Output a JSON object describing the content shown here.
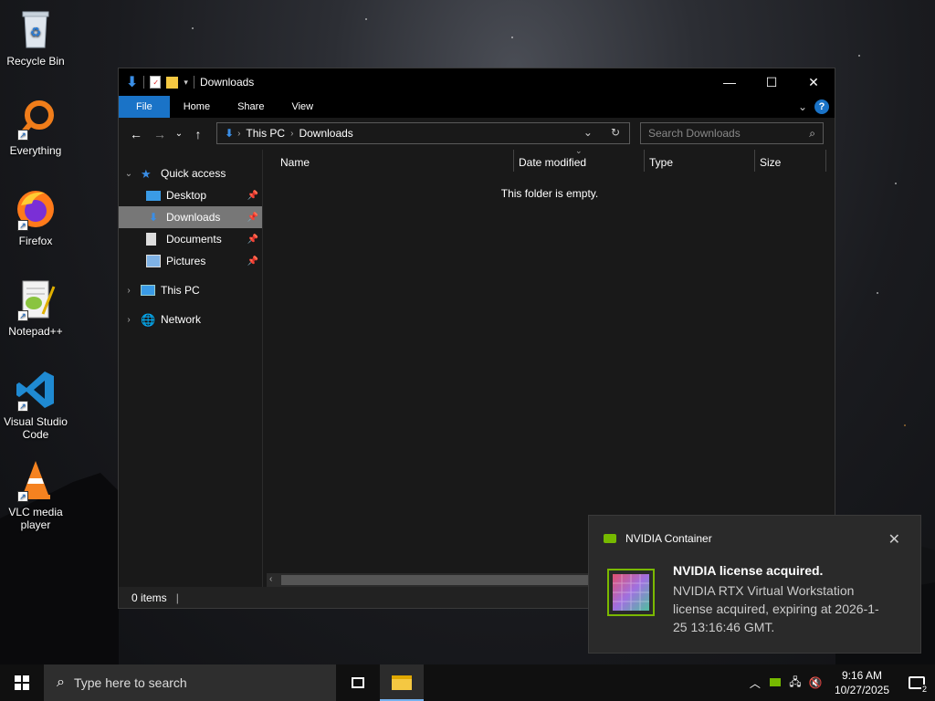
{
  "desktop": {
    "icons": [
      {
        "label": "Recycle Bin",
        "icon": "recycle-bin-icon"
      },
      {
        "label": "Everything",
        "icon": "everything-icon"
      },
      {
        "label": "Firefox",
        "icon": "firefox-icon"
      },
      {
        "label": "Notepad++",
        "icon": "notepadpp-icon"
      },
      {
        "label": "Visual Studio Code",
        "icon": "vscode-icon"
      },
      {
        "label": "VLC media player",
        "icon": "vlc-icon"
      }
    ]
  },
  "explorer": {
    "title": "Downloads",
    "ribbon_tabs": [
      "File",
      "Home",
      "Share",
      "View"
    ],
    "breadcrumb": [
      "This PC",
      "Downloads"
    ],
    "search_placeholder": "Search Downloads",
    "nav": {
      "quick_access": "Quick access",
      "items": [
        "Desktop",
        "Downloads",
        "Documents",
        "Pictures"
      ],
      "this_pc": "This PC",
      "network": "Network"
    },
    "columns": [
      "Name",
      "Date modified",
      "Type",
      "Size"
    ],
    "empty_message": "This folder is empty.",
    "status": "0 items"
  },
  "notification": {
    "app": "NVIDIA Container",
    "title": "NVIDIA license acquired.",
    "body": "NVIDIA RTX Virtual Workstation license acquired, expiring at 2026-1-25 13:16:46 GMT."
  },
  "taskbar": {
    "search_placeholder": "Type here to search",
    "time": "9:16 AM",
    "date": "10/27/2025",
    "notification_count": "2"
  },
  "colors": {
    "accent": "#1a73c7",
    "nvidia": "#76b900"
  }
}
